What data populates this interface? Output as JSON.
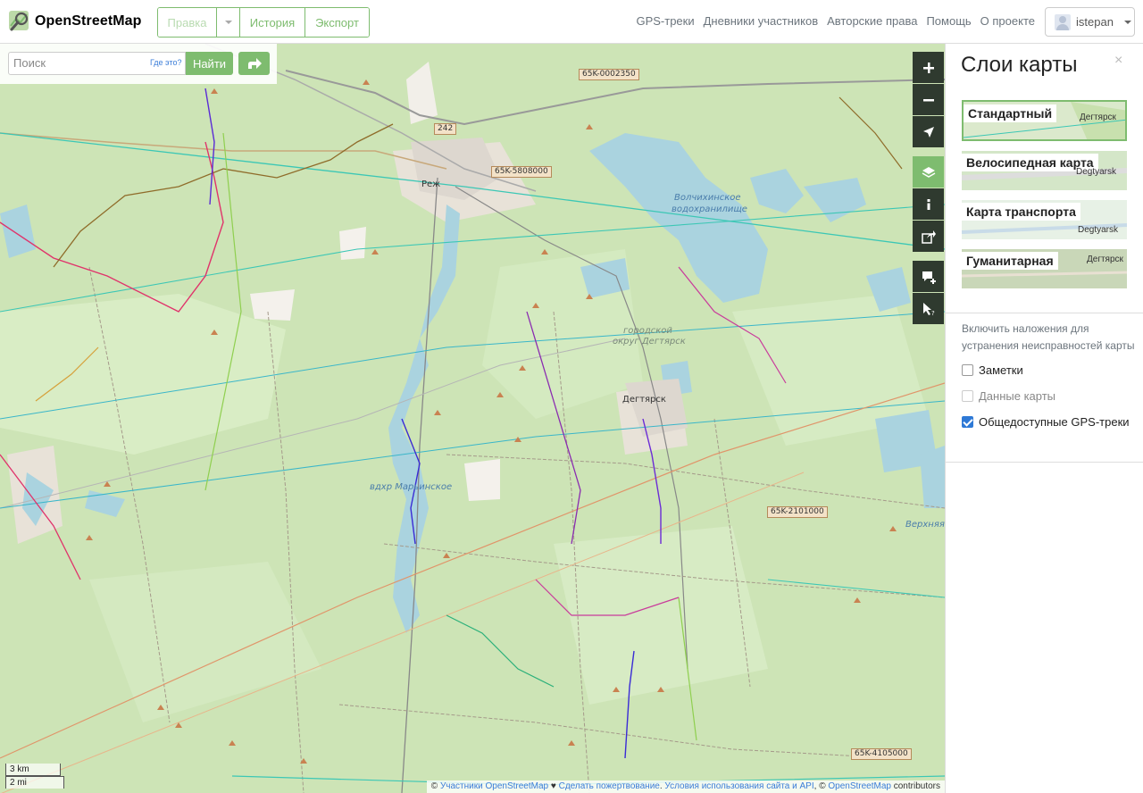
{
  "header": {
    "logo_text": "OpenStreetMap",
    "edit_label": "Правка",
    "history_label": "История",
    "export_label": "Экспорт",
    "nav": [
      "GPS-треки",
      "Дневники участников",
      "Авторские права",
      "Помощь",
      "О проекте"
    ],
    "username": "istepan"
  },
  "search": {
    "placeholder": "Поиск",
    "where_label": "Где это?",
    "go_label": "Найти"
  },
  "map": {
    "labels": {
      "city_rezh": "Реж",
      "reservoir": "Волчихинское",
      "reservoir2": "водохранилище",
      "district": "городской",
      "district2": "округ Дегтярск",
      "town": "Дегтярск",
      "pond": "вдхр Марьинское",
      "village": "Верхняя",
      "road1": "65K-0002350",
      "road2": "65K-5808000",
      "road3": "65K-2101000",
      "road4": "65K-4105000",
      "road5": "242"
    },
    "scale_km": "3 km",
    "scale_mi": "2 mi",
    "attribution": {
      "copy": "©",
      "contributors_link": "Участники OpenStreetMap",
      "heart": "♥",
      "donate_link": "Сделать пожертвование",
      "dot": ".",
      "terms_link": "Условия использования сайта и API",
      "sep": ", ©",
      "osm_link": "OpenStreetMap",
      "tail": "contributors"
    }
  },
  "sidebar": {
    "title": "Слои карты",
    "close": "×",
    "layers": [
      {
        "label": "Стандартный",
        "preview": "Дегтярск",
        "selected": true
      },
      {
        "label": "Велосипедная карта",
        "preview": "Degtyarsk",
        "selected": false
      },
      {
        "label": "Карта транспорта",
        "preview": "Degtyarsk",
        "selected": false
      },
      {
        "label": "Гуманитарная",
        "preview": "Дегтярск",
        "selected": false
      }
    ],
    "overlay_info": "Включить наложения для устранения неисправностей карты",
    "overlays": [
      {
        "label": "Заметки",
        "checked": false,
        "disabled": false
      },
      {
        "label": "Данные карты",
        "checked": false,
        "disabled": true
      },
      {
        "label": "Общедоступные GPS-треки",
        "checked": true,
        "disabled": false
      }
    ]
  }
}
